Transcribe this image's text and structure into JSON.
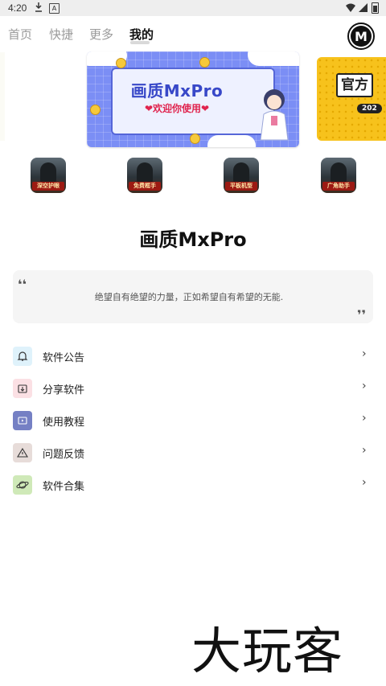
{
  "status_bar": {
    "time": "4:20",
    "icons": [
      "download-icon",
      "a-icon",
      "wifi-icon",
      "signal-icon",
      "battery-icon"
    ]
  },
  "tabs": [
    {
      "label": "首页",
      "active": false
    },
    {
      "label": "快捷",
      "active": false
    },
    {
      "label": "更多",
      "active": false
    },
    {
      "label": "我的",
      "active": true
    }
  ],
  "logo": {
    "letter": "M"
  },
  "banners": {
    "main": {
      "title": "画质MxPro",
      "subtitle": "❤欢迎你使用❤"
    },
    "next": {
      "title": "官方",
      "year": "202"
    }
  },
  "featured_apps": [
    {
      "label": "深空护眼"
    },
    {
      "label": "免费框手"
    },
    {
      "label": "平板机型"
    },
    {
      "label": "广角助手"
    }
  ],
  "app_name": "画质MxPro",
  "quote": {
    "open_mark": "❛❛",
    "text": "绝望自有绝望的力量，正如希望自有希望的无能.",
    "close_mark": "❜❜"
  },
  "menu": [
    {
      "label": "软件公告",
      "icon": "bell-icon",
      "color": "#dff2fb"
    },
    {
      "label": "分享软件",
      "icon": "share-folder-icon",
      "color": "#fbe0e4"
    },
    {
      "label": "使用教程",
      "icon": "video-tutorial-icon",
      "color": "#7580c4"
    },
    {
      "label": "问题反馈",
      "icon": "warning-icon",
      "color": "#e7dcd9"
    },
    {
      "label": "软件合集",
      "icon": "planet-icon",
      "color": "#cfe9b8"
    }
  ],
  "menu_arrow": "›",
  "watermark": "大玩客"
}
